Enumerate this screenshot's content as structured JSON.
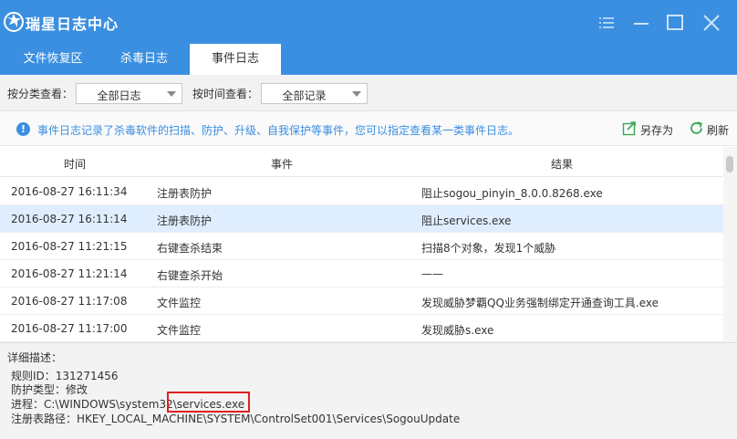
{
  "window": {
    "title": "瑞星日志中心",
    "brand_color": "#3b8fe0"
  },
  "icons": {
    "logo": "rising-lion-logo-icon",
    "menu": "menu-icon",
    "minimize": "minimize-icon",
    "maximize": "maximize-icon",
    "close": "close-icon",
    "info": "info-icon",
    "save_as": "export-icon",
    "refresh": "refresh-icon"
  },
  "tabs": [
    {
      "label": "文件恢复区",
      "active": false
    },
    {
      "label": "杀毒日志",
      "active": false
    },
    {
      "label": "事件日志",
      "active": true
    }
  ],
  "filters": {
    "category_label": "按分类查看：",
    "category_value": "全部日志",
    "time_label": "按时间查看：",
    "time_value": "全部记录"
  },
  "info": {
    "icon_glyph": "!",
    "text": "事件日志记录了杀毒软件的扫描、防护、升级、自我保护等事件，您可以指定查看某一类事件日志。",
    "save_as": "另存为",
    "refresh": "刷新"
  },
  "table": {
    "columns": [
      "时间",
      "事件",
      "结果"
    ],
    "rows": [
      {
        "time": "2016-08-27 16:11:34",
        "event": "注册表防护",
        "result": "阻止sogou_pinyin_8.0.0.8268.exe",
        "selected": false
      },
      {
        "time": "2016-08-27 16:11:14",
        "event": "注册表防护",
        "result": "阻止services.exe",
        "selected": true
      },
      {
        "time": "2016-08-27 11:21:15",
        "event": "右键查杀结束",
        "result": "扫描8个对象，发现1个威胁",
        "selected": false
      },
      {
        "time": "2016-08-27 11:21:14",
        "event": "右键查杀开始",
        "result": "——",
        "selected": false
      },
      {
        "time": "2016-08-27 11:17:08",
        "event": "文件监控",
        "result": "发现威胁梦覇QQ业务强制绑定开通查询工具.exe",
        "selected": false
      },
      {
        "time": "2016-08-27 11:17:00",
        "event": "文件监控",
        "result": "发现威胁s.exe",
        "selected": false
      }
    ]
  },
  "detail": {
    "title": "详细描述：",
    "rule_id": "规则ID：131271456",
    "protect_type": "防护类型：修改",
    "process": "进程：C:\\WINDOWS\\system32\\services.exe",
    "reg_path": "注册表路径：HKEY_LOCAL_MACHINE\\SYSTEM\\ControlSet001\\Services\\SogouUpdate"
  }
}
